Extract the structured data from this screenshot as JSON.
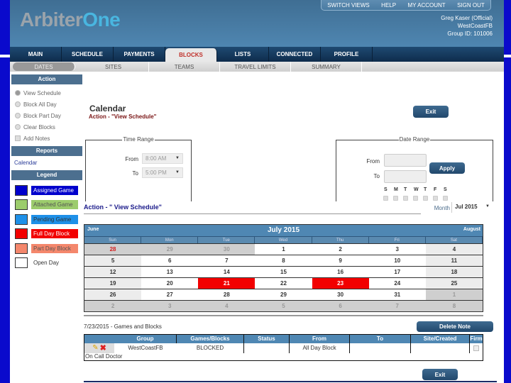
{
  "header": {
    "logo_part1": "Arbiter",
    "logo_part2": "One",
    "top_links": [
      "SWITCH VIEWS",
      "HELP",
      "MY ACCOUNT",
      "SIGN OUT"
    ],
    "user_name": "Greg Kaser (Official)",
    "group_name": "WestCoastFB",
    "group_id": "Group ID: 101006"
  },
  "main_nav": [
    {
      "label": "MAIN"
    },
    {
      "label": "SCHEDULE"
    },
    {
      "label": "PAYMENTS"
    },
    {
      "label": "BLOCKS",
      "active": true
    },
    {
      "label": "LISTS"
    },
    {
      "label": "CONNECTED"
    },
    {
      "label": "PROFILE"
    }
  ],
  "sub_nav": [
    {
      "label": "DATES",
      "active": true
    },
    {
      "label": "SITES"
    },
    {
      "label": "TEAMS"
    },
    {
      "label": "TRAVEL LIMITS"
    },
    {
      "label": "SUMMARY"
    }
  ],
  "sidebar": {
    "action_header": "Action",
    "actions": [
      {
        "label": "View Schedule",
        "selected": true
      },
      {
        "label": "Block All Day"
      },
      {
        "label": "Block Part Day"
      },
      {
        "label": "Clear Blocks"
      }
    ],
    "add_notes": "Add Notes",
    "reports_header": "Reports",
    "reports_link": "Calendar",
    "legend_header": "Legend",
    "legend": [
      {
        "label": "Assigned Game",
        "color": "#0000cc",
        "text_color": "#ffffff"
      },
      {
        "label": "Attached Game",
        "color": "#9ccc6c",
        "text_color": "#555555"
      },
      {
        "label": "Pending Game",
        "color": "#1e90e8",
        "text_color": "#333333"
      },
      {
        "label": "Full Day Block",
        "color": "#f20000",
        "text_color": "#ffffff"
      },
      {
        "label": "Part Day Block",
        "color": "#f4876c",
        "text_color": "#555555"
      },
      {
        "label": "Open Day",
        "color": "#ffffff",
        "text_color": "#333333"
      }
    ]
  },
  "main": {
    "title": "Calendar",
    "subtitle": "Action - \"View Schedule\"",
    "exit_label": "Exit",
    "time_range": {
      "legend": "Time Range",
      "from_label": "From",
      "from_value": "8:00 AM",
      "to_label": "To",
      "to_value": "5:00 PM"
    },
    "date_range": {
      "legend": "Date Range",
      "from_label": "From",
      "to_label": "To",
      "from_value": "",
      "to_value": "",
      "apply_label": "Apply",
      "days": [
        "S",
        "M",
        "T",
        "W",
        "T",
        "F",
        "S"
      ]
    },
    "action_heading": "Action - \" View Schedule\"",
    "month_label": "Month",
    "month_value": "Jul 2015"
  },
  "calendar": {
    "prev": "June",
    "current": "July 2015",
    "next": "August",
    "dow": [
      "Sun",
      "Mon",
      "Tue",
      "Wed",
      "Thu",
      "Fri",
      "Sat"
    ],
    "weeks": [
      [
        {
          "d": "28",
          "c": "out red"
        },
        {
          "d": "29",
          "c": "out"
        },
        {
          "d": "30",
          "c": "out"
        },
        {
          "d": "1"
        },
        {
          "d": "2"
        },
        {
          "d": "3"
        },
        {
          "d": "4",
          "c": "wk"
        }
      ],
      [
        {
          "d": "5",
          "c": "wk"
        },
        {
          "d": "6"
        },
        {
          "d": "7"
        },
        {
          "d": "8"
        },
        {
          "d": "9"
        },
        {
          "d": "10"
        },
        {
          "d": "11",
          "c": "wk"
        }
      ],
      [
        {
          "d": "12",
          "c": "wk"
        },
        {
          "d": "13"
        },
        {
          "d": "14"
        },
        {
          "d": "15"
        },
        {
          "d": "16"
        },
        {
          "d": "17"
        },
        {
          "d": "18",
          "c": "wk"
        }
      ],
      [
        {
          "d": "19",
          "c": "wk"
        },
        {
          "d": "20"
        },
        {
          "d": "21",
          "c": "full"
        },
        {
          "d": "22"
        },
        {
          "d": "23",
          "c": "full"
        },
        {
          "d": "24"
        },
        {
          "d": "25",
          "c": "wk"
        }
      ],
      [
        {
          "d": "26",
          "c": "wk"
        },
        {
          "d": "27"
        },
        {
          "d": "28"
        },
        {
          "d": "29"
        },
        {
          "d": "30"
        },
        {
          "d": "31"
        },
        {
          "d": "1",
          "c": "out"
        }
      ],
      [
        {
          "d": "2",
          "c": "out"
        },
        {
          "d": "3",
          "c": "out"
        },
        {
          "d": "4",
          "c": "out"
        },
        {
          "d": "5",
          "c": "out"
        },
        {
          "d": "6",
          "c": "out"
        },
        {
          "d": "7",
          "c": "out"
        },
        {
          "d": "8",
          "c": "out"
        }
      ]
    ]
  },
  "games": {
    "title": "7/23/2015 - Games and Blocks",
    "delete_note_label": "Delete Note",
    "columns": [
      "",
      "Group",
      "Games/Blocks",
      "Status",
      "From",
      "To",
      "Site/Created",
      "Firm"
    ],
    "rows": [
      {
        "group": "WestCoastFB",
        "games_blocks": "BLOCKED",
        "status": "",
        "from": "All Day Block",
        "to": "",
        "site_created": "",
        "firm": false,
        "note": "On Call Doctor"
      }
    ],
    "exit_label": "Exit"
  }
}
